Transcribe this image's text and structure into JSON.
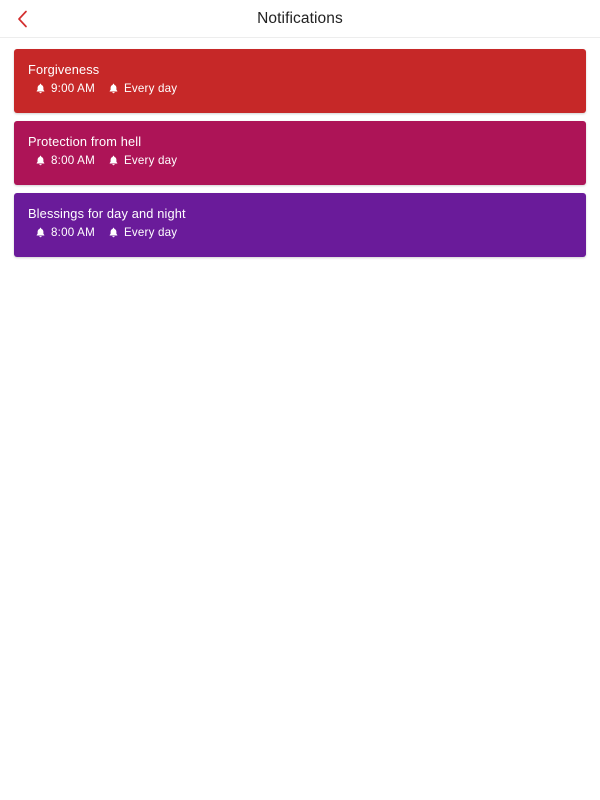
{
  "header": {
    "title": "Notifications",
    "back_icon": "chevron-left-icon",
    "back_icon_color": "#D32F2F",
    "title_color": "#222222",
    "background": "#FFFFFF",
    "divider_color": "#EDEDED"
  },
  "notifications": [
    {
      "title": "Forgiveness",
      "time": "9:00 AM",
      "repeat": "Every day",
      "time_icon": "bell-icon",
      "repeat_icon": "bell-icon",
      "color": "#C62828"
    },
    {
      "title": "Protection from hell",
      "time": "8:00 AM",
      "repeat": "Every day",
      "time_icon": "bell-icon",
      "repeat_icon": "bell-icon",
      "color": "#AD1457"
    },
    {
      "title": "Blessings for day and night",
      "time": "8:00 AM",
      "repeat": "Every day",
      "time_icon": "bell-icon",
      "repeat_icon": "bell-icon",
      "color": "#6A1B9A"
    }
  ]
}
